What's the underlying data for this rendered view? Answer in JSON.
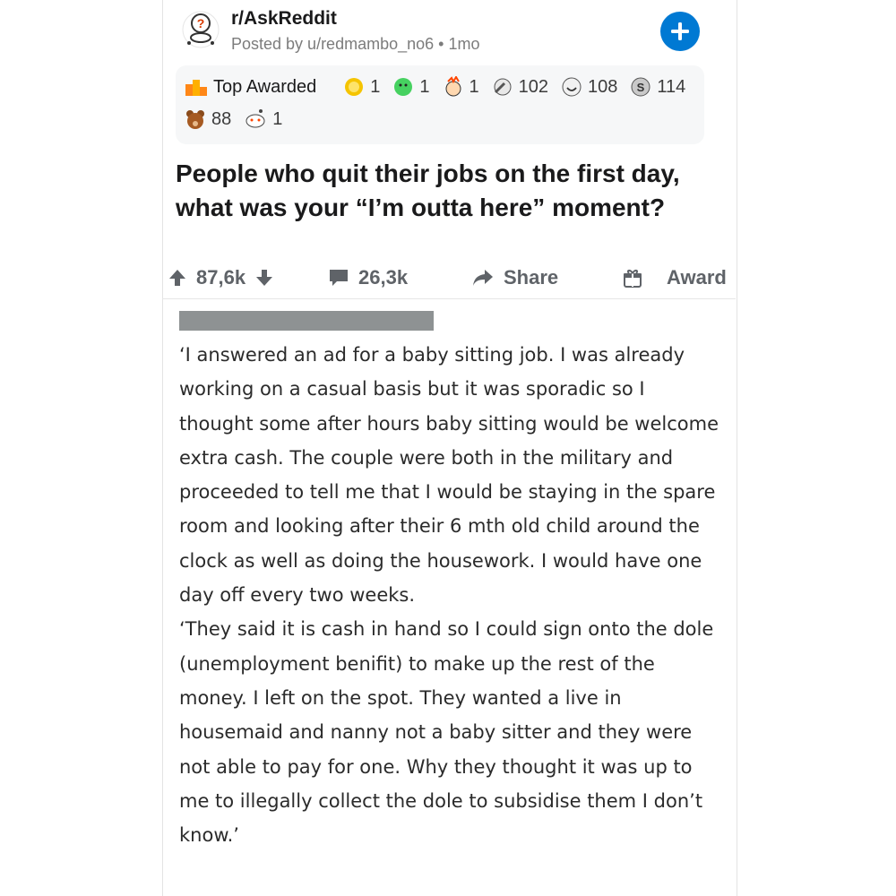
{
  "header": {
    "subreddit": "r/AskReddit",
    "posted_by": "Posted by u/redmambo_no6 • 1mo",
    "avatar_icon": "askreddit-snoo-icon",
    "plus_icon": "plus-icon"
  },
  "awards": {
    "top_label": "Top Awarded",
    "items": [
      {
        "icon": "gold-sun-award-icon",
        "count": "1"
      },
      {
        "icon": "green-face-award-icon",
        "count": "1"
      },
      {
        "icon": "mind-blown-award-icon",
        "count": "1"
      },
      {
        "icon": "facepalm-award-icon",
        "count": "102"
      },
      {
        "icon": "laugh-award-icon",
        "count": "108"
      },
      {
        "icon": "silver-coin-award-icon",
        "count": "114"
      },
      {
        "icon": "bear-award-icon",
        "count": "88"
      },
      {
        "icon": "snoo-award-icon",
        "count": "1"
      }
    ]
  },
  "post": {
    "title": "People who quit their jobs on the first day, what was your “I’m outta here” moment?"
  },
  "actions": {
    "score": "87,6k",
    "comments": "26,3k",
    "share": "Share",
    "award": "Award"
  },
  "comment": {
    "paragraphs": [
      "‘I answered an ad for a baby sitting job. I was already working on a casual basis but it was sporadic so I thought some after hours baby sitting would be welcome extra cash. The couple were both in the military and proceeded to tell me that I would be staying in the spare room and looking after their 6 mth old child around the clock as well as doing the housework. I would have one day off every two weeks.",
      "‘They said it is cash in hand so I could sign onto the dole (unemployment benifit) to make up the rest of the money. I left on the spot. They wanted a live in housemaid and nanny not a baby sitter and they were not able to pay for one. Why they thought it was up to me to illegally collect the dole to subsidise them I don’t know.’"
    ]
  },
  "colors": {
    "accent": "#0079d3",
    "muted": "#7c7c7c",
    "redaction": "#8e9293"
  }
}
